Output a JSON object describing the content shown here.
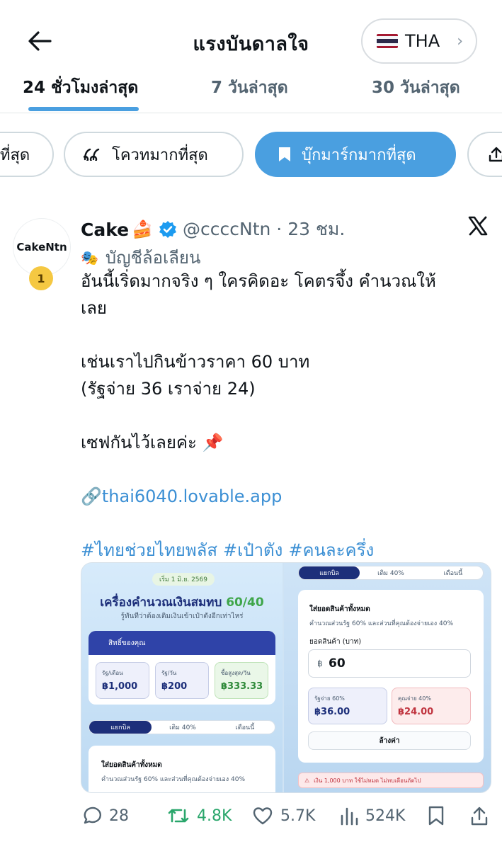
{
  "header": {
    "title": "แรงบันดาลใจ",
    "region": {
      "flag_colors": [
        "#a51931",
        "#f4f5f8",
        "#2d2a4a",
        "#f4f5f8",
        "#a51931"
      ],
      "code": "THA"
    }
  },
  "tabs": [
    {
      "label": "24 ชั่วโมงล่าสุด"
    },
    {
      "label": "7 วันล่าสุด"
    },
    {
      "label": "30 วันล่าสุด"
    }
  ],
  "chips": [
    {
      "label": "ที่สุด"
    },
    {
      "label": "โควทมากที่สุด",
      "icon": "quote-icon"
    },
    {
      "label": "บุ๊กมาร์กมากที่สุด",
      "icon": "bookmark-icon"
    }
  ],
  "post": {
    "avatar_text": "CakeNtn",
    "rank": "1",
    "display_name": "Cake",
    "name_emoji": "🍰",
    "handle_time": "@ccccNtn · 23 ชม.",
    "account_label": "บัญชีล้อเลียน",
    "lines": {
      "l1": "อันนี้เริ่ดมากจริง ๆ ใครคิดอะ โคตรจึ้ง คำนวณให้",
      "l2": "เลย",
      "l3": "เช่นเราไปกินข้าวราคา 60 บาท",
      "l4": "(รัฐจ่าย 36 เราจ่าย 24)",
      "l5": "เซฟกันไว้เลยค่ะ 📌",
      "link": "thai6040.lovable.app",
      "hashtags": [
        "#ไทยช่วยไทยพลัส",
        "#เป๋าตัง",
        "#คนละครึ่ง"
      ]
    },
    "media": {
      "date_pill": "เริ่ม 1 มิ.ย. 2569",
      "title_a": "เครื่องคำนวณเงินสมทบ ",
      "title_b": "60/40",
      "subtitle": "รู้ทันทีว่าต้องเติมเงินเข้าเป๋าตังอีกเท่าไหร่",
      "rights_header": "สิทธิ์ของคุณ",
      "boxes": [
        {
          "label": "รัฐ/เดือน",
          "value": "฿1,000"
        },
        {
          "label": "รัฐ/วัน",
          "value": "฿200"
        },
        {
          "label": "ซื้อสูงสุด/วัน",
          "value": "฿333.33"
        }
      ],
      "tabs": [
        "แยกบิล",
        "เติม 40%",
        "เดือนนี้"
      ],
      "section_title": "ใส่ยอดสินค้าทั้งหมด",
      "section_note": "คำนวณส่วนรัฐ 60% และส่วนที่คุณต้องจ่ายเอง 40%",
      "input_label": "ยอดสินค้า (บาท)",
      "input_prefix": "฿",
      "input_value": "60",
      "gov_label": "รัฐจ่าย 60%",
      "gov_value": "฿36.00",
      "you_label": "คุณจ่าย 40%",
      "you_value": "฿24.00",
      "clear_label": "ล้างค่า",
      "warning": "เงิน 1,000 บาท ใช้ไม่หมด ไม่ทบเดือนถัดไป"
    },
    "stats": {
      "replies": "28",
      "reposts": "4.8K",
      "likes": "5.7K",
      "views": "524K"
    }
  },
  "colors": {
    "accent": "#4a9fe0",
    "link": "#3b8fd4",
    "repost_green": "#29a66b",
    "verified": "#1d9bf0"
  }
}
